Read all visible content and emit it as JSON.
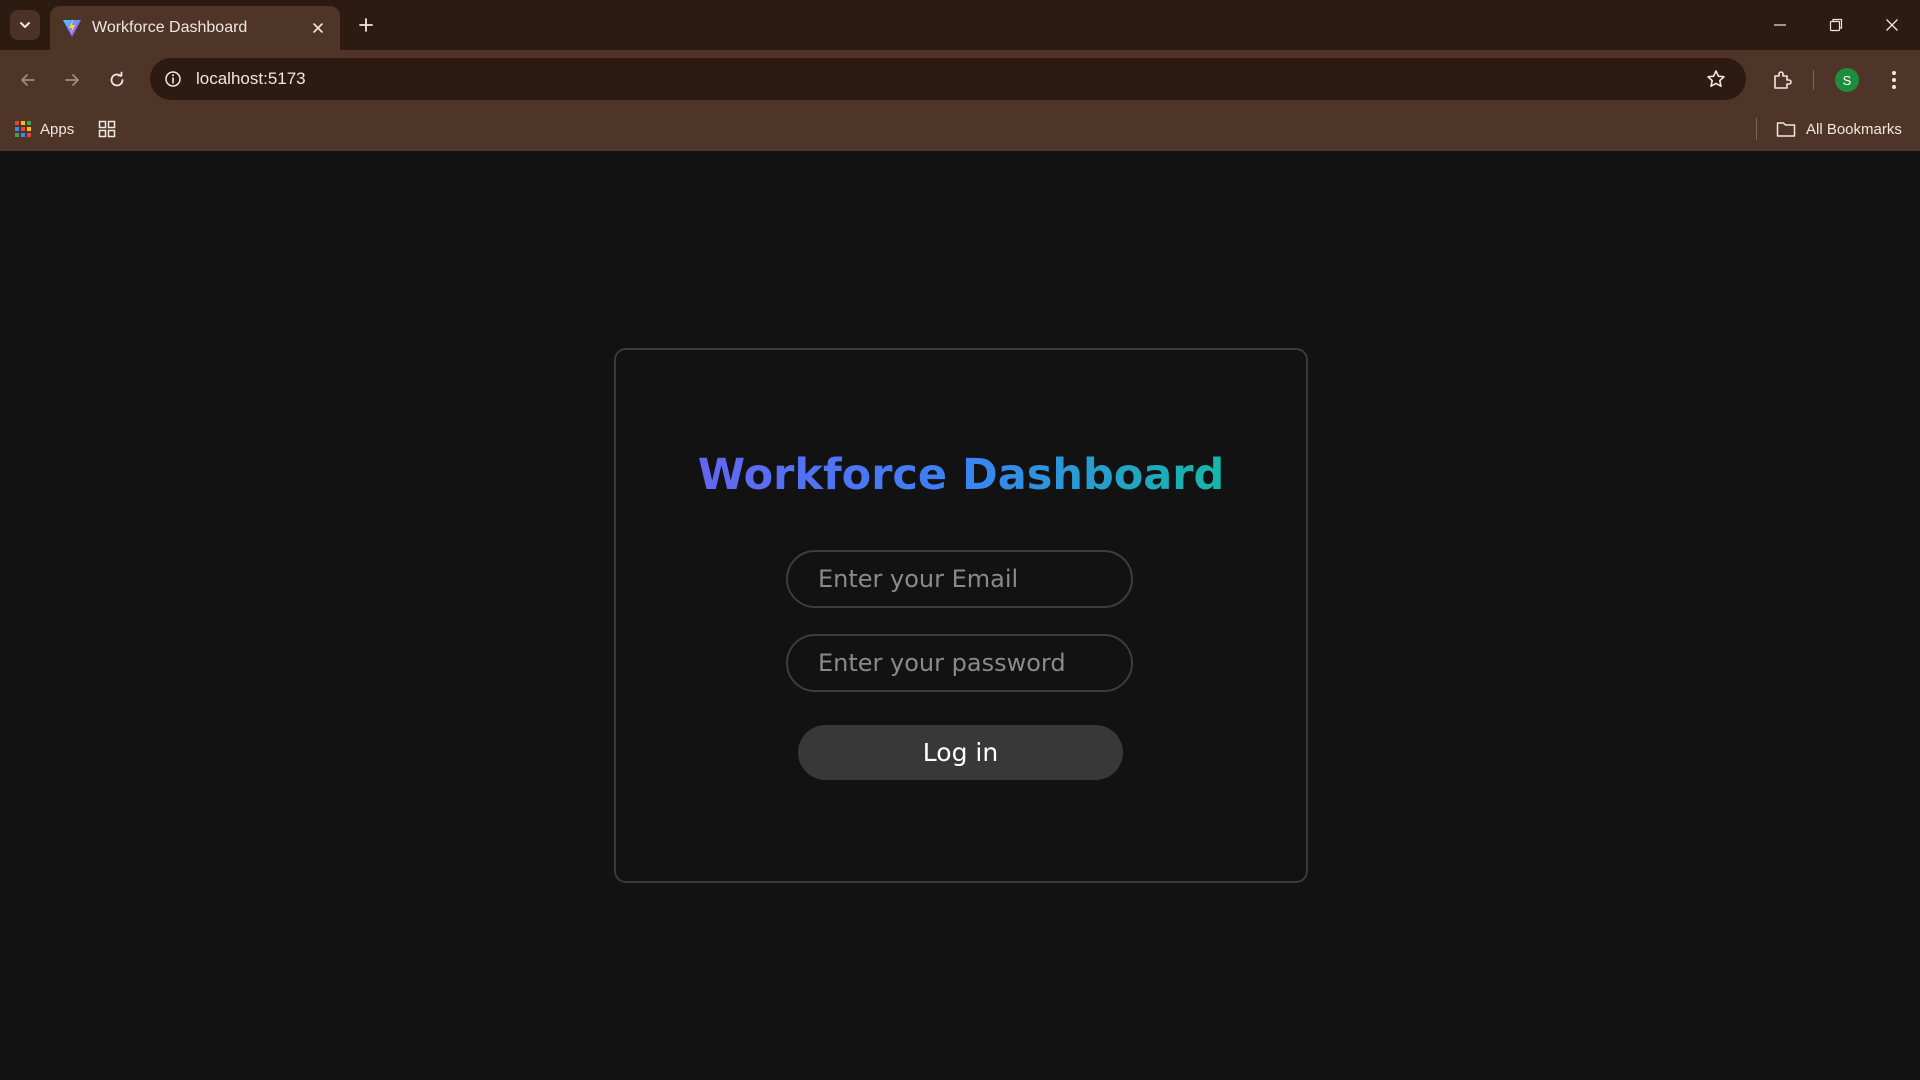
{
  "browser": {
    "tab_title": "Workforce Dashboard",
    "url": "localhost:5173",
    "profile_initial": "S",
    "bookmarks": {
      "apps_label": "Apps",
      "all_bookmarks_label": "All Bookmarks"
    }
  },
  "login": {
    "title": "Workforce Dashboard",
    "email_placeholder": "Enter your Email",
    "password_placeholder": "Enter your password",
    "submit_label": "Log in"
  },
  "colors": {
    "title_gradient": [
      "#6366f1",
      "#3b82f6",
      "#14b8a6"
    ],
    "page_background": "#121212",
    "button_background": "#383838"
  }
}
